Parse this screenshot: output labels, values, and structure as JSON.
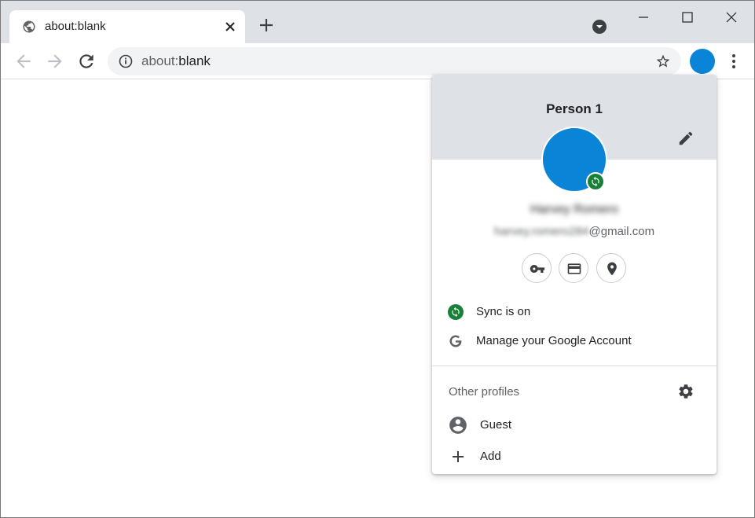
{
  "tab": {
    "title": "about:blank",
    "favicon": "globe-icon"
  },
  "omnibox": {
    "scheme": "about:",
    "host": "blank"
  },
  "colors": {
    "tabstrip": "#dee1e6",
    "avatar": "#0a84d6",
    "sync_green": "#188038"
  },
  "popup": {
    "profile_name": "Person 1",
    "account_name": "Harvey Romero",
    "email_user": "harvey.romero284",
    "email_domain": "@gmail.com",
    "sync_label": "Sync is on",
    "manage_label": "Manage your Google Account",
    "other_profiles_label": "Other profiles",
    "guest_label": "Guest",
    "add_label": "Add"
  }
}
